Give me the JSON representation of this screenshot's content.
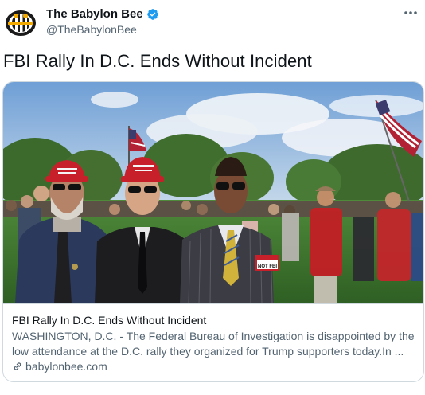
{
  "account": {
    "display_name": "The Babylon Bee",
    "handle": "@TheBabylonBee"
  },
  "tweet": {
    "text": "FBI Rally In D.C. Ends Without Incident"
  },
  "card": {
    "title": "FBI Rally In D.C. Ends Without Incident",
    "description": "WASHINGTON, D.C. - The Federal Bureau of Investigation is disappointed by the low attendance at the D.C. rally they organized for Trump supporters today.In ...",
    "domain": "babylonbee.com",
    "image": {
      "hat_text": "MAKE AMERICA GREAT AGAIN",
      "name_tag": "NOT FBI"
    }
  },
  "colors": {
    "verified": "#1d9bf0",
    "secondary_text": "#536471",
    "border": "#cfd9de"
  },
  "icons": [
    "babylon-bee-logo",
    "verified-badge-icon",
    "more-icon",
    "link-icon"
  ]
}
